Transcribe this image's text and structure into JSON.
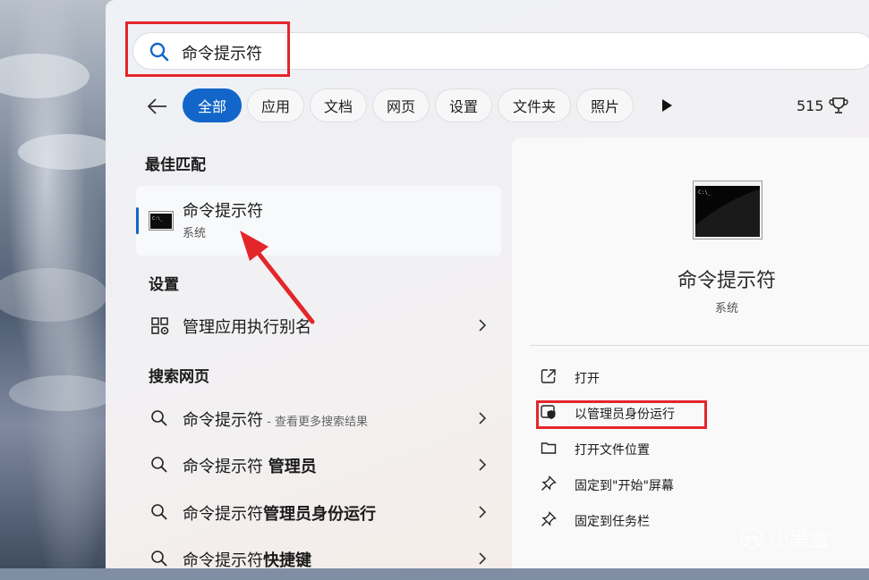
{
  "search": {
    "query": "命令提示符"
  },
  "filters": {
    "tabs": [
      {
        "label": "全部",
        "active": true
      },
      {
        "label": "应用"
      },
      {
        "label": "文档"
      },
      {
        "label": "网页"
      },
      {
        "label": "设置"
      },
      {
        "label": "文件夹"
      },
      {
        "label": "照片"
      }
    ],
    "points": "515"
  },
  "best_match": {
    "title": "最佳匹配",
    "name": "命令提示符",
    "category": "系统"
  },
  "settings_section": {
    "title": "设置",
    "items": [
      {
        "label": "管理应用执行别名"
      }
    ]
  },
  "web_section": {
    "title": "搜索网页",
    "items": [
      {
        "label": "命令提示符",
        "bold": "",
        "hint": " - 查看更多搜索结果"
      },
      {
        "label": "命令提示符 ",
        "bold": "管理员",
        "hint": ""
      },
      {
        "label": "命令提示符",
        "bold": "管理员身份运行",
        "hint": ""
      },
      {
        "label": "命令提示符",
        "bold": "快捷键",
        "hint": ""
      }
    ]
  },
  "detail": {
    "title": "命令提示符",
    "subtitle": "系统",
    "actions": [
      {
        "label": "打开"
      },
      {
        "label": "以管理员身份运行"
      },
      {
        "label": "打开文件位置"
      },
      {
        "label": "固定到\"开始\"屏幕"
      },
      {
        "label": "固定到任务栏"
      }
    ]
  },
  "watermark": "小黑盒",
  "colors": {
    "accent": "#1366c9",
    "highlight": "#e3262a"
  }
}
